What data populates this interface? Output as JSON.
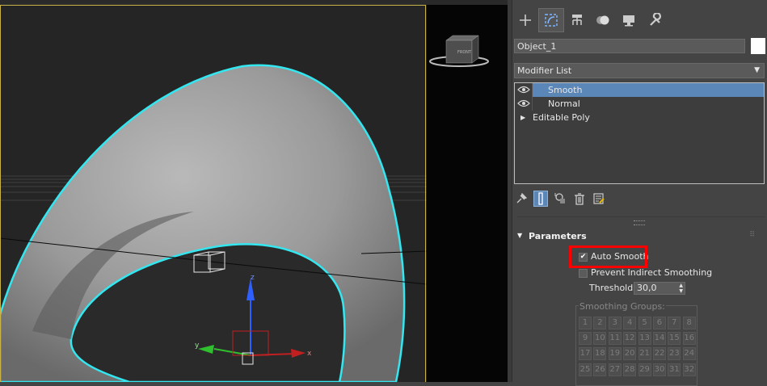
{
  "viewport": {
    "viewcube_label": "FRONT",
    "axis_labels": {
      "z": "z",
      "y": "y",
      "x": "x"
    }
  },
  "command_panel": {
    "tabs": [
      {
        "name": "create",
        "icon": "plus-icon"
      },
      {
        "name": "modify",
        "icon": "modify-icon",
        "active": true
      },
      {
        "name": "hierarchy",
        "icon": "hierarchy-icon"
      },
      {
        "name": "motion",
        "icon": "motion-icon"
      },
      {
        "name": "display",
        "icon": "display-icon"
      },
      {
        "name": "utilities",
        "icon": "wrench-icon"
      }
    ],
    "object_name": "Object_1",
    "object_color": "#ffffff",
    "modifier_list_label": "Modifier List",
    "stack": [
      {
        "label": "Smooth",
        "selected": true,
        "visible": true
      },
      {
        "label": "Normal",
        "selected": false,
        "visible": true
      },
      {
        "label": "Editable Poly",
        "selected": false,
        "base": true
      }
    ],
    "stack_tools": [
      "pin-stack-icon",
      "show-end-result-icon",
      "make-unique-icon",
      "remove-modifier-icon",
      "configure-modifier-sets-icon"
    ],
    "rollout": {
      "title": "Parameters",
      "auto_smooth_label": "Auto Smooth",
      "auto_smooth_checked": true,
      "prevent_indirect_label": "Prevent Indirect Smoothing",
      "prevent_indirect_checked": false,
      "threshold_label": "Threshold:",
      "threshold_value": "30,0",
      "smoothing_groups_label": "Smoothing Groups:",
      "groups": [
        "1",
        "2",
        "3",
        "4",
        "5",
        "6",
        "7",
        "8",
        "9",
        "10",
        "11",
        "12",
        "13",
        "14",
        "15",
        "16",
        "17",
        "18",
        "19",
        "20",
        "21",
        "22",
        "23",
        "24",
        "25",
        "26",
        "27",
        "28",
        "29",
        "30",
        "31",
        "32"
      ]
    }
  },
  "colors": {
    "selection_outline": "#33e6f0",
    "viewport_border": "#c8b34a",
    "selected_row": "#5b86b8",
    "highlight": "#ff0000"
  }
}
